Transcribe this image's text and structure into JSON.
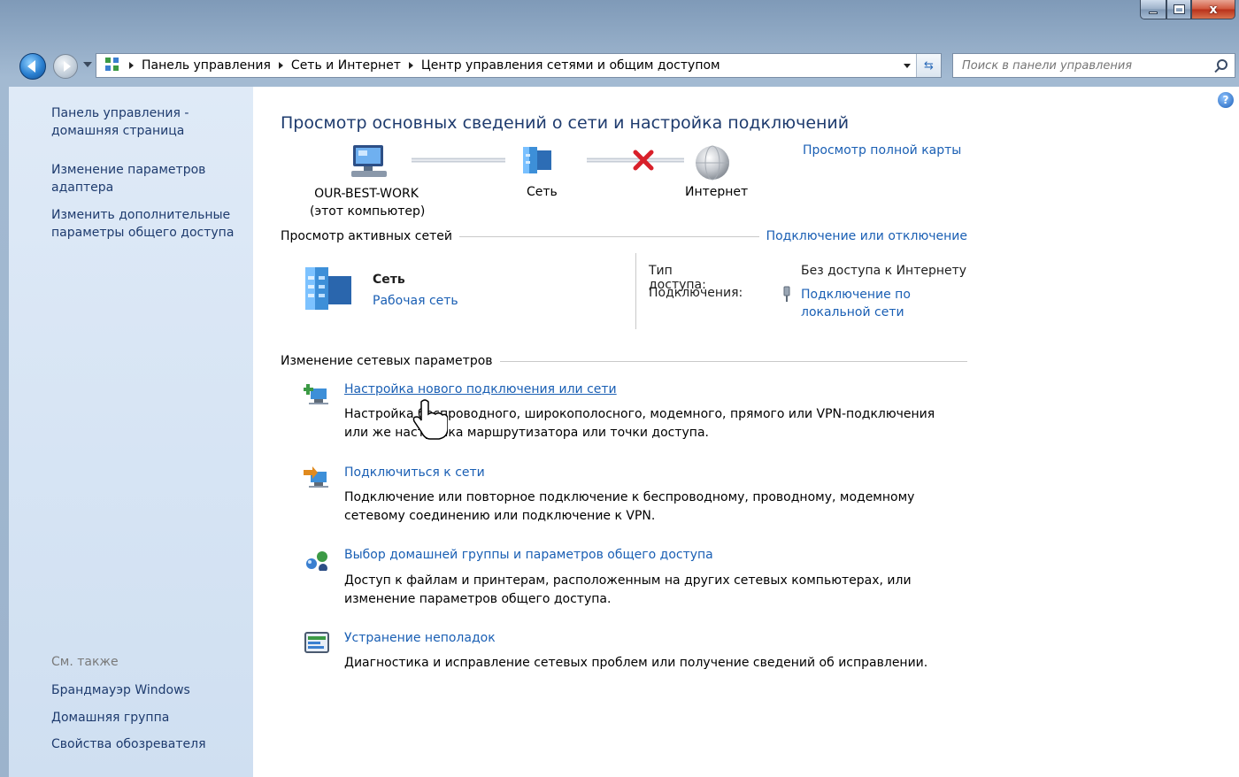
{
  "window": {
    "minimize_icon": "minimize-icon",
    "maximize_icon": "maximize-icon",
    "close_label": "x"
  },
  "addressbar": {
    "crumbs": [
      "Панель управления",
      "Сеть и Интернет",
      "Центр управления сетями и общим доступом"
    ],
    "search_placeholder": "Поиск в панели управления"
  },
  "sidebar": {
    "home_link": "Панель управления - домашняя страница",
    "adapter_link": "Изменение параметров адаптера",
    "sharing_link": "Изменить дополнительные параметры общего доступа",
    "see_also": "См. также",
    "see_also_links": [
      "Брандмауэр Windows",
      "Домашняя группа",
      "Свойства обозревателя"
    ]
  },
  "main": {
    "title": "Просмотр основных сведений о сети и настройка подключений",
    "full_map_link": "Просмотр полной карты",
    "network_map": {
      "computer_name": "OUR-BEST-WORK",
      "computer_sub": "(этот компьютер)",
      "network_label": "Сеть",
      "internet_label": "Интернет"
    },
    "active_networks": {
      "heading": "Просмотр активных сетей",
      "connect_link": "Подключение или отключение",
      "network_name": "Сеть",
      "network_type_link": "Рабочая сеть",
      "access_type_label": "Тип доступа:",
      "access_type_value": "Без доступа к Интернету",
      "connections_label": "Подключения:",
      "connection_link_line1": "Подключение по",
      "connection_link_line2": "локальной сети"
    },
    "change_settings": {
      "heading": "Изменение сетевых параметров",
      "tasks": [
        {
          "link": "Настройка нового подключения или сети",
          "desc1": "Настройка беспроводного, широкополосного, модемного, прямого или VPN-подключения",
          "desc2": "или же настройка маршрутизатора или точки доступа."
        },
        {
          "link": "Подключиться к сети",
          "desc1": "Подключение или повторное подключение к беспроводному, проводному, модемному",
          "desc2": "сетевому соединению или подключение к VPN."
        },
        {
          "link": "Выбор домашней группы и параметров общего доступа",
          "desc1": "Доступ к файлам и принтерам, расположенным на других сетевых компьютерах, или",
          "desc2": "изменение параметров общего доступа."
        },
        {
          "link": "Устранение неполадок",
          "desc1": "Диагностика и исправление сетевых проблем или получение сведений об исправлении."
        }
      ]
    }
  },
  "colors": {
    "link": "#1a5fb4",
    "title": "#1e3b6e",
    "sidebar_bg": "#dfeaf7",
    "error_x": "#d8202a"
  }
}
